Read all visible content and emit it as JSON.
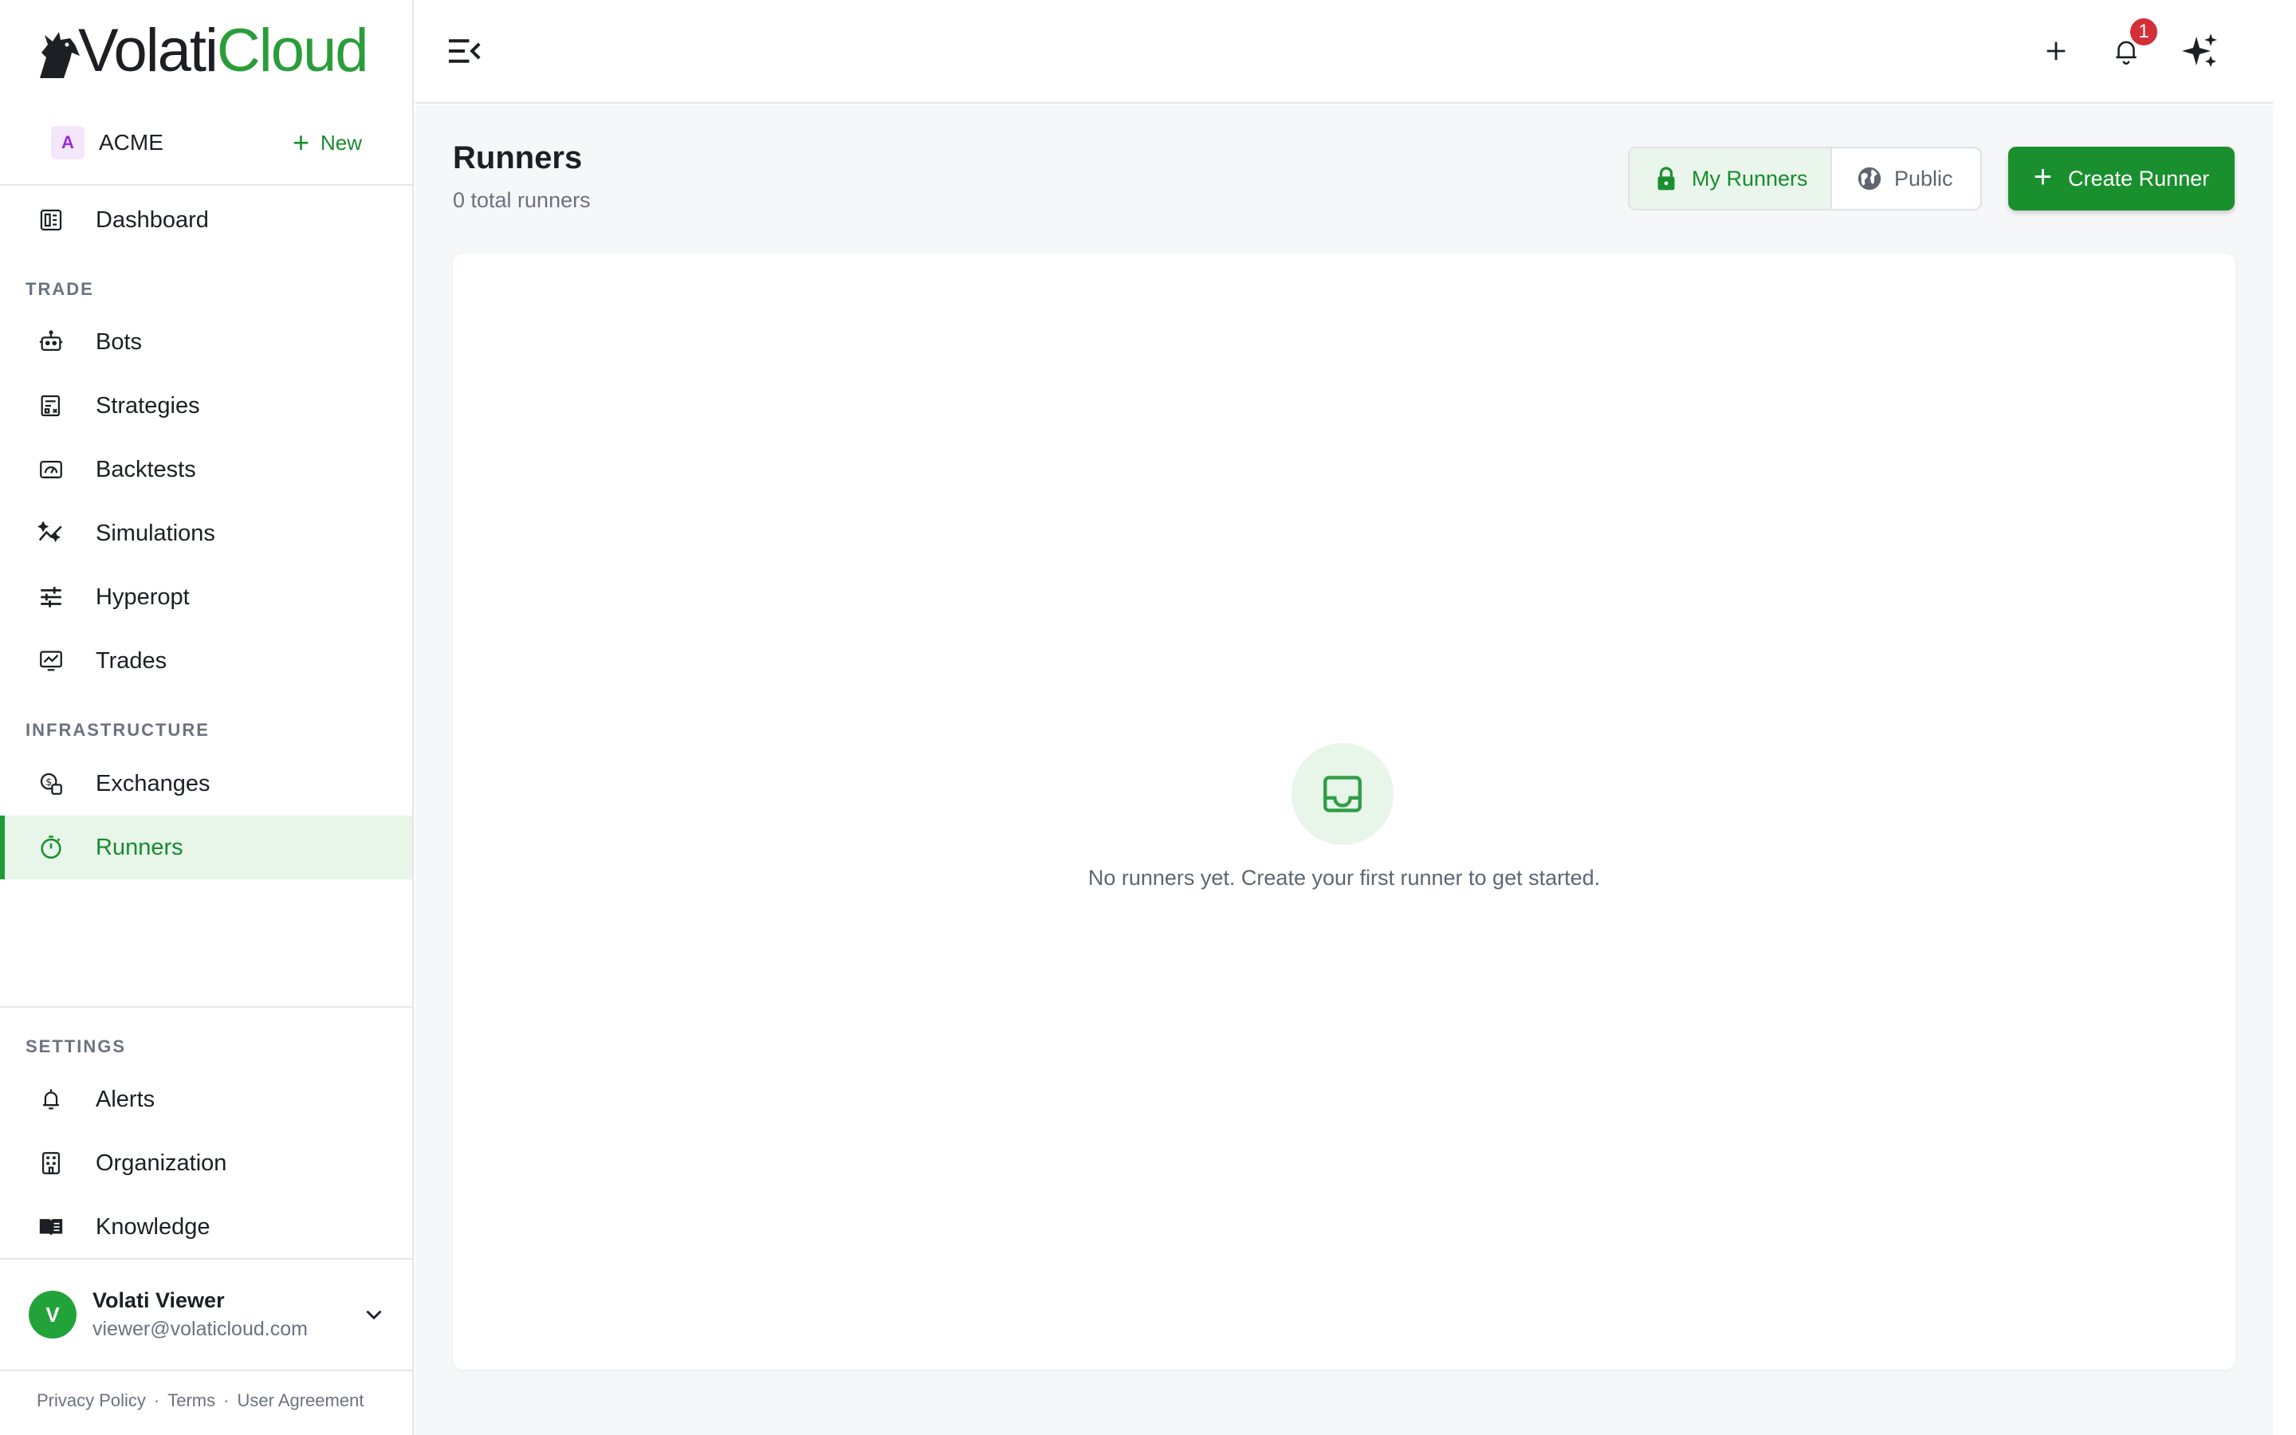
{
  "brand": {
    "name_part1": "Volati",
    "name_part2": "Cloud",
    "accent": "#1a8f2e"
  },
  "org": {
    "badge": "A",
    "name": "ACME",
    "new_label": "New"
  },
  "nav": {
    "dashboard": "Dashboard",
    "sections": {
      "trade": "TRADE",
      "infrastructure": "INFRASTRUCTURE",
      "settings": "SETTINGS"
    },
    "items": {
      "bots": "Bots",
      "strategies": "Strategies",
      "backtests": "Backtests",
      "simulations": "Simulations",
      "hyperopt": "Hyperopt",
      "trades": "Trades",
      "exchanges": "Exchanges",
      "runners": "Runners",
      "alerts": "Alerts",
      "organization": "Organization",
      "knowledge": "Knowledge"
    },
    "active": "runners"
  },
  "user": {
    "initial": "V",
    "name": "Volati Viewer",
    "email": "viewer@volaticloud.com"
  },
  "footer": {
    "privacy": "Privacy Policy",
    "sep": "·",
    "terms": "Terms",
    "agreement": "User Agreement"
  },
  "topbar": {
    "notification_count": "1"
  },
  "page": {
    "title": "Runners",
    "subtitle": "0 total runners",
    "toggle": {
      "mine": "My Runners",
      "public": "Public",
      "selected": "mine"
    },
    "create_label": "Create Runner",
    "empty_message": "No runners yet. Create your first runner to get started."
  }
}
